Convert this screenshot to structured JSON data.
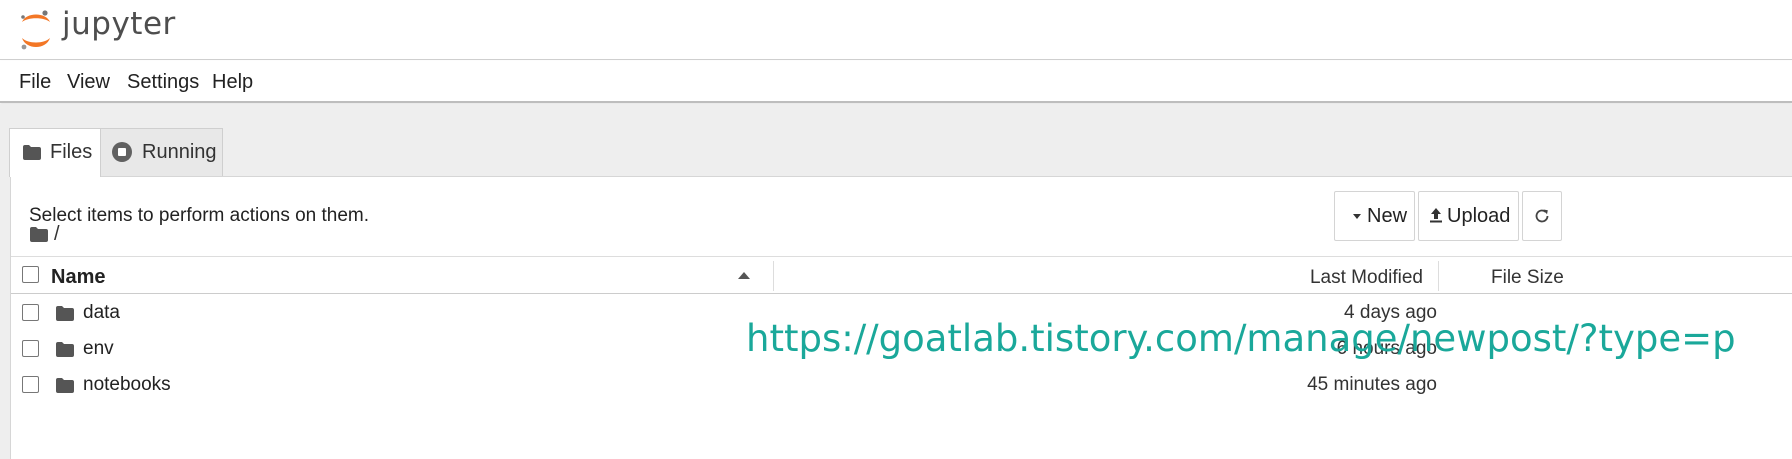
{
  "header": {
    "logo_text": "jupyter"
  },
  "menubar": {
    "items": [
      "File",
      "View",
      "Settings",
      "Help"
    ]
  },
  "tabs": [
    {
      "label": "Files",
      "icon": "folder-icon",
      "active": true
    },
    {
      "label": "Running",
      "icon": "stop-circle-icon",
      "active": false
    }
  ],
  "toolbar": {
    "hint": "Select items to perform actions on them.",
    "new_label": "New",
    "upload_label": "Upload",
    "refresh_icon": "refresh-icon"
  },
  "breadcrumb": {
    "path": "/"
  },
  "list": {
    "columns": {
      "name": "Name",
      "modified": "Last Modified",
      "size": "File Size"
    },
    "sort": {
      "column": "Name",
      "direction": "ascending"
    },
    "rows": [
      {
        "name": "data",
        "modified": "4 days ago",
        "type": "folder"
      },
      {
        "name": "env",
        "modified": "6 hours ago",
        "type": "folder"
      },
      {
        "name": "notebooks",
        "modified": "45 minutes ago",
        "type": "folder"
      }
    ]
  },
  "watermark": {
    "text": "https://goatlab.tistory.com/manage/newpost/?type=p"
  },
  "colors": {
    "logo_orange": "#F37726",
    "watermark": "#1aa89a",
    "tab_bg": "#eeeeee"
  }
}
